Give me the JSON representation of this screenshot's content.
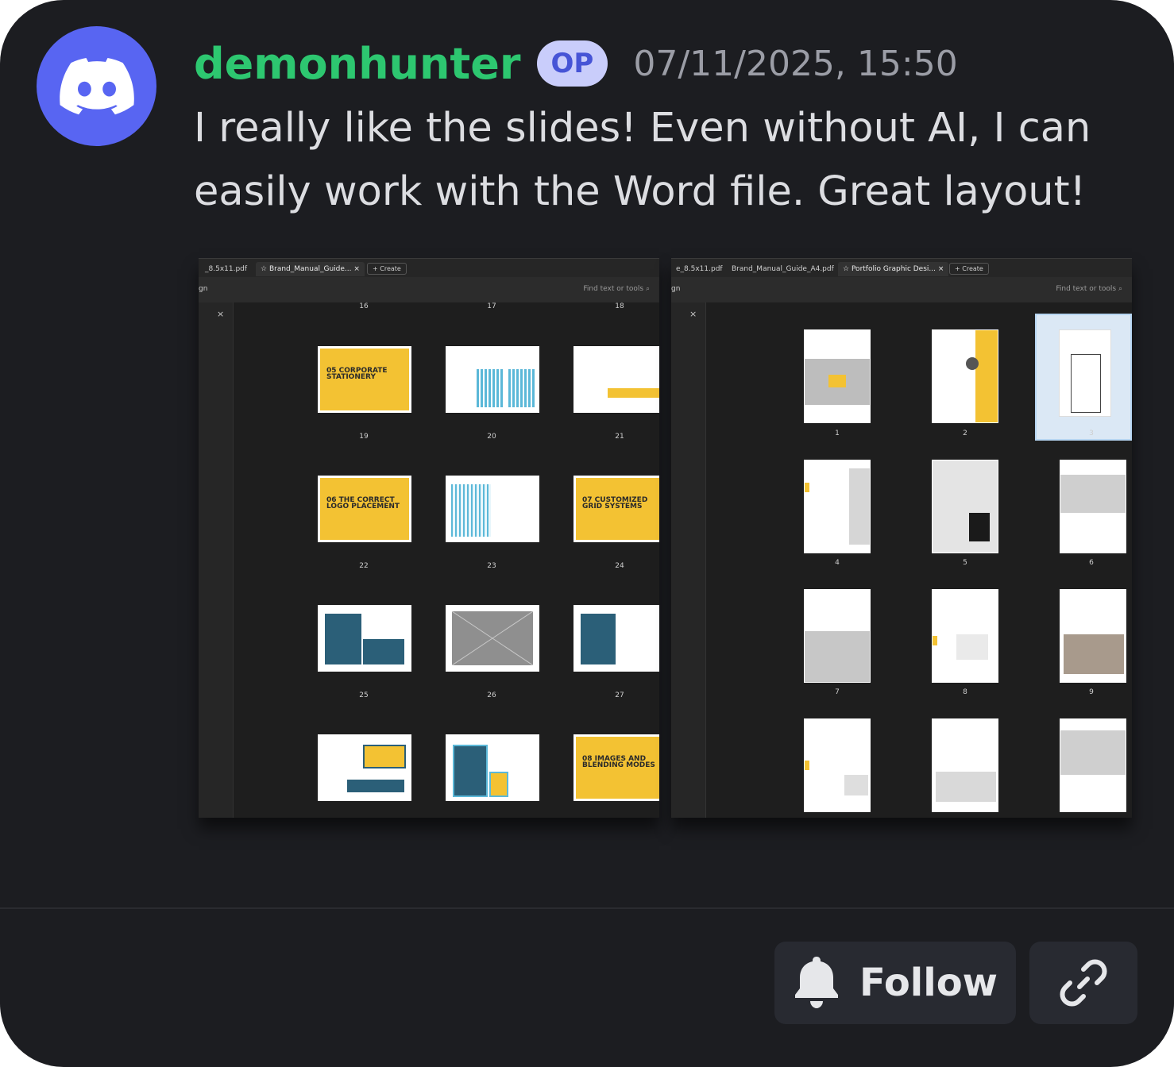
{
  "post": {
    "username": "demonhunter",
    "badge": "OP",
    "timestamp": "07/11/2025, 15:50",
    "message": "I really like the slides! Even without AI, I can easily work with the Word file. Great layout!",
    "avatar_icon": "discord-logo-icon",
    "colors": {
      "username": "#2dc770",
      "avatar_bg": "#5865f2",
      "badge_bg": "#c9cdfb",
      "badge_text": "#4654d6"
    }
  },
  "screenshots": {
    "left": {
      "tabs": [
        "_8.5x11.pdf",
        "Brand_Manual_Guide...",
        "Create"
      ],
      "toolbar_label": "gn",
      "find_label": "Find text or tools",
      "top_numbers": [
        "16",
        "17",
        "18"
      ],
      "pages": [
        "19",
        "20",
        "21",
        "22",
        "23",
        "24",
        "25",
        "26",
        "27"
      ],
      "slide_titles": [
        "05 CORPORATE STATIONERY",
        "06 THE CORRECT LOGO PLACEMENT",
        "07 CUSTOMIZED GRID SYSTEMS",
        "08 IMAGES AND BLENDING MODES"
      ]
    },
    "right": {
      "tabs": [
        "e_8.5x11.pdf",
        "Brand_Manual_Guide_A4.pdf",
        "Portfolio Graphic Desi...",
        "Create"
      ],
      "toolbar_label": "gn",
      "find_label": "Find text or tools",
      "pages": [
        "1",
        "2",
        "3",
        "4",
        "5",
        "6",
        "7",
        "8",
        "9"
      ]
    }
  },
  "actions": {
    "follow_label": "Follow",
    "follow_icon": "bell-icon",
    "link_icon": "link-icon"
  }
}
